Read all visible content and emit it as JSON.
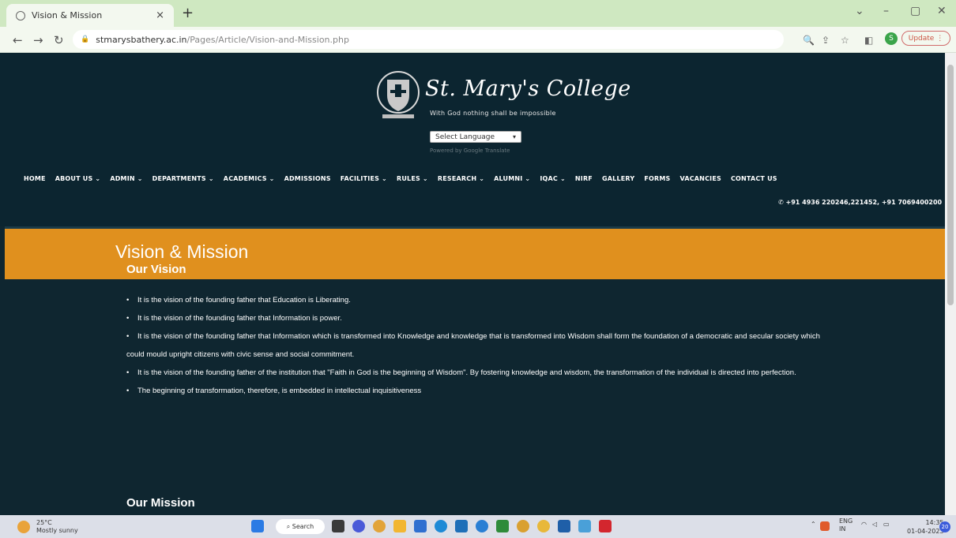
{
  "browser": {
    "tab_title": "Vision & Mission",
    "tab_close": "×",
    "new_tab": "+",
    "url_domain": "stmarysbathery.ac.in",
    "url_path": "/Pages/Article/Vision-and-Mission.php",
    "profile_initial": "S",
    "update_label": "Update"
  },
  "site": {
    "college_name": "St. Mary's College",
    "motto": "With God nothing shall be impossible",
    "language_select": "Select Language",
    "powered_by": "Powered by Google Translate",
    "menu": [
      "HOME",
      "ABOUT US ⌄",
      "ADMIN ⌄",
      "DEPARTMENTS ⌄",
      "ACADEMICS ⌄",
      "ADMISSIONS",
      "FACILITIES ⌄",
      "RULES ⌄",
      "RESEARCH ⌄",
      "ALUMNI ⌄",
      "IQAC ⌄",
      "NIRF",
      "GALLERY",
      "FORMS",
      "VACANCIES",
      "CONTACT US"
    ],
    "phone": "+91 4936 220246,221452, +91 7069400200"
  },
  "banner": {
    "title": "Vision & Mission"
  },
  "vision": {
    "title_prefix": "Our ",
    "title_bold": "Vision",
    "items": [
      "It is the vision of the founding father that Education is Liberating.",
      "It is the vision of the founding father that Information is power.",
      "It is the vision of the founding father that Information which is transformed into Knowledge and knowledge that is transformed into Wisdom shall form the foundation of a democratic and secular society which could mould upright citizens with civic sense and social commitment.",
      "It is the vision of the founding father of the institution that \"Faith in God is the beginning of Wisdom\". By fostering knowledge and wisdom, the transformation of the individual is directed into perfection.",
      "The beginning of transformation, therefore, is embedded in intellectual inquisitiveness"
    ]
  },
  "mission": {
    "title_prefix": "Our ",
    "title_bold": "Mission"
  },
  "taskbar": {
    "temp": "25°C",
    "weather": "Mostly sunny",
    "search": "Search",
    "lang_top": "ENG",
    "lang_bottom": "IN",
    "time": "14:35",
    "date": "01-04-2023",
    "notif_count": "20"
  },
  "colors": {
    "page_bg": "#0f2630",
    "banner": "#e0901e",
    "tabbar": "#cfe8c1"
  }
}
